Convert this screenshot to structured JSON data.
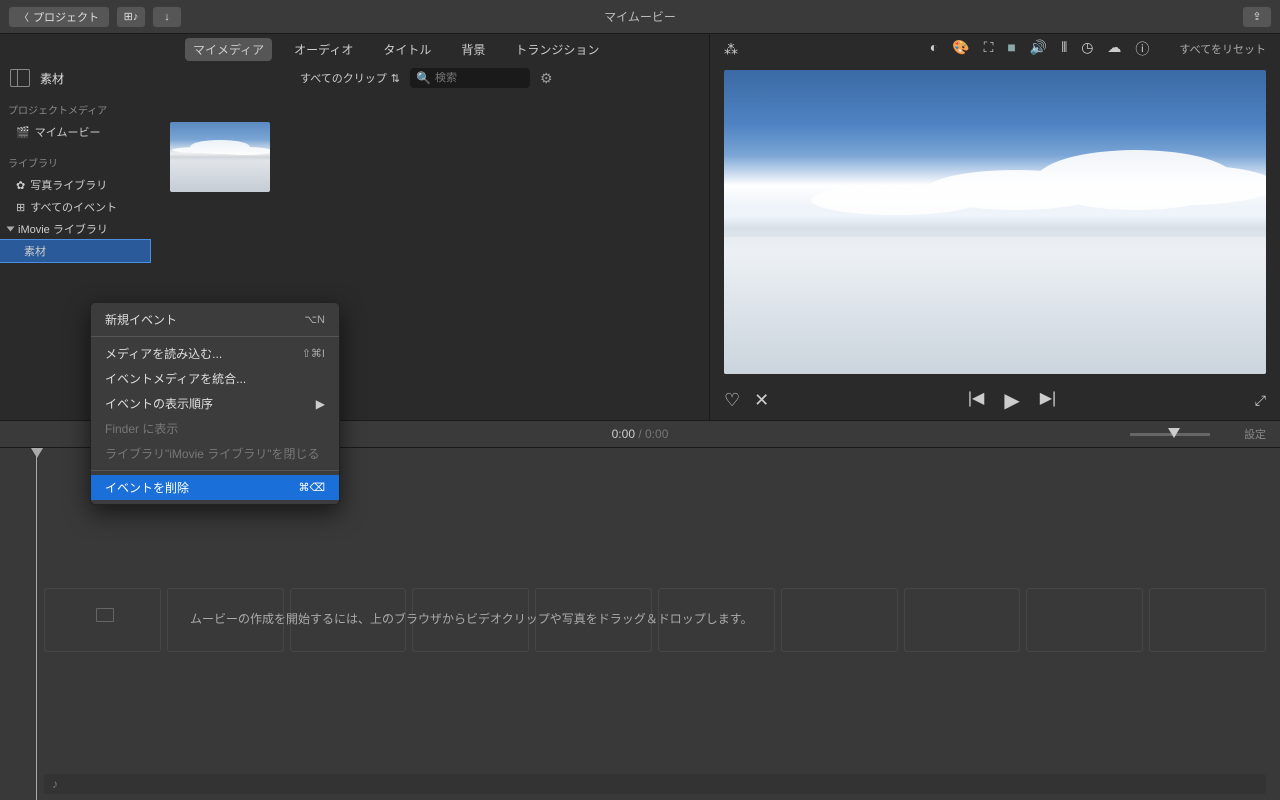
{
  "toolbar": {
    "back_label": "プロジェクト",
    "title": "マイムービー"
  },
  "tabs": [
    "マイメディア",
    "オーディオ",
    "タイトル",
    "背景",
    "トランジション"
  ],
  "browser": {
    "title": "素材",
    "filter": "すべてのクリップ",
    "search_placeholder": "検索"
  },
  "sidebar": {
    "project_media_header": "プロジェクトメディア",
    "project_item": "マイムービー",
    "library_header": "ライブラリ",
    "photo_library": "写真ライブラリ",
    "all_events": "すべてのイベント",
    "imovie_library": "iMovie ライブラリ",
    "event_name": "素材"
  },
  "context_menu": {
    "new_event": "新規イベント",
    "new_event_sc": "⌥N",
    "import_media": "メディアを読み込む...",
    "import_media_sc": "⇧⌘I",
    "consolidate": "イベントメディアを統合...",
    "sort_order": "イベントの表示順序",
    "show_in_finder": "Finder に表示",
    "close_library": "ライブラリ\"iMovie ライブラリ\"を閉じる",
    "delete_event": "イベントを削除",
    "delete_event_sc": "⌘⌫"
  },
  "adjust": {
    "reset": "すべてをリセット"
  },
  "transport": {
    "current": "0:00",
    "duration": "0:00",
    "settings": "設定"
  },
  "timeline": {
    "hint": "ムービーの作成を開始するには、上のブラウザからビデオクリップや写真をドラッグ＆ドロップします。"
  }
}
